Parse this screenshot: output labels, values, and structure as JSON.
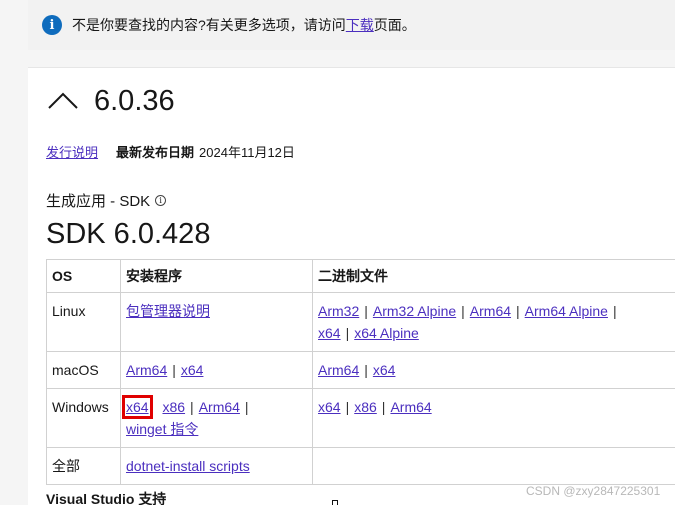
{
  "notice": {
    "icon": "info-icon",
    "text": "不是你要查找的内容?有关更多选项，请访问",
    "link": "下载",
    "suffix": "页面。"
  },
  "release": {
    "version": "6.0.36",
    "notes_link": "发行说明",
    "date_label": "最新发布日期",
    "date_value": "2024年11月12日"
  },
  "sdk": {
    "subheading": "生成应用 - SDK",
    "title": "SDK 6.0.428",
    "table": {
      "headers": [
        "OS",
        "安装程序",
        "二进制文件"
      ],
      "rows": {
        "linux": {
          "os": "Linux",
          "installer": [
            "包管理器说明"
          ],
          "binaries": [
            "Arm32",
            "Arm32 Alpine",
            "Arm64",
            "Arm64 Alpine",
            "x64",
            "x64 Alpine"
          ]
        },
        "macos": {
          "os": "macOS",
          "installer": [
            "Arm64",
            "x64"
          ],
          "binaries": [
            "Arm64",
            "x64"
          ]
        },
        "windows": {
          "os": "Windows",
          "installer": [
            "x64",
            "x86",
            "Arm64",
            "winget 指令"
          ],
          "binaries": [
            "x64",
            "x86",
            "Arm64"
          ]
        },
        "all": {
          "os": "全部",
          "installer": [
            "dotnet-install scripts"
          ],
          "binaries": []
        }
      }
    }
  },
  "vs_support": "Visual Studio 支持",
  "watermark": "CSDN @zxy2847225301",
  "colors": {
    "link": "#4b2fbf",
    "info": "#0f6cbd",
    "highlight": "#e00000"
  }
}
